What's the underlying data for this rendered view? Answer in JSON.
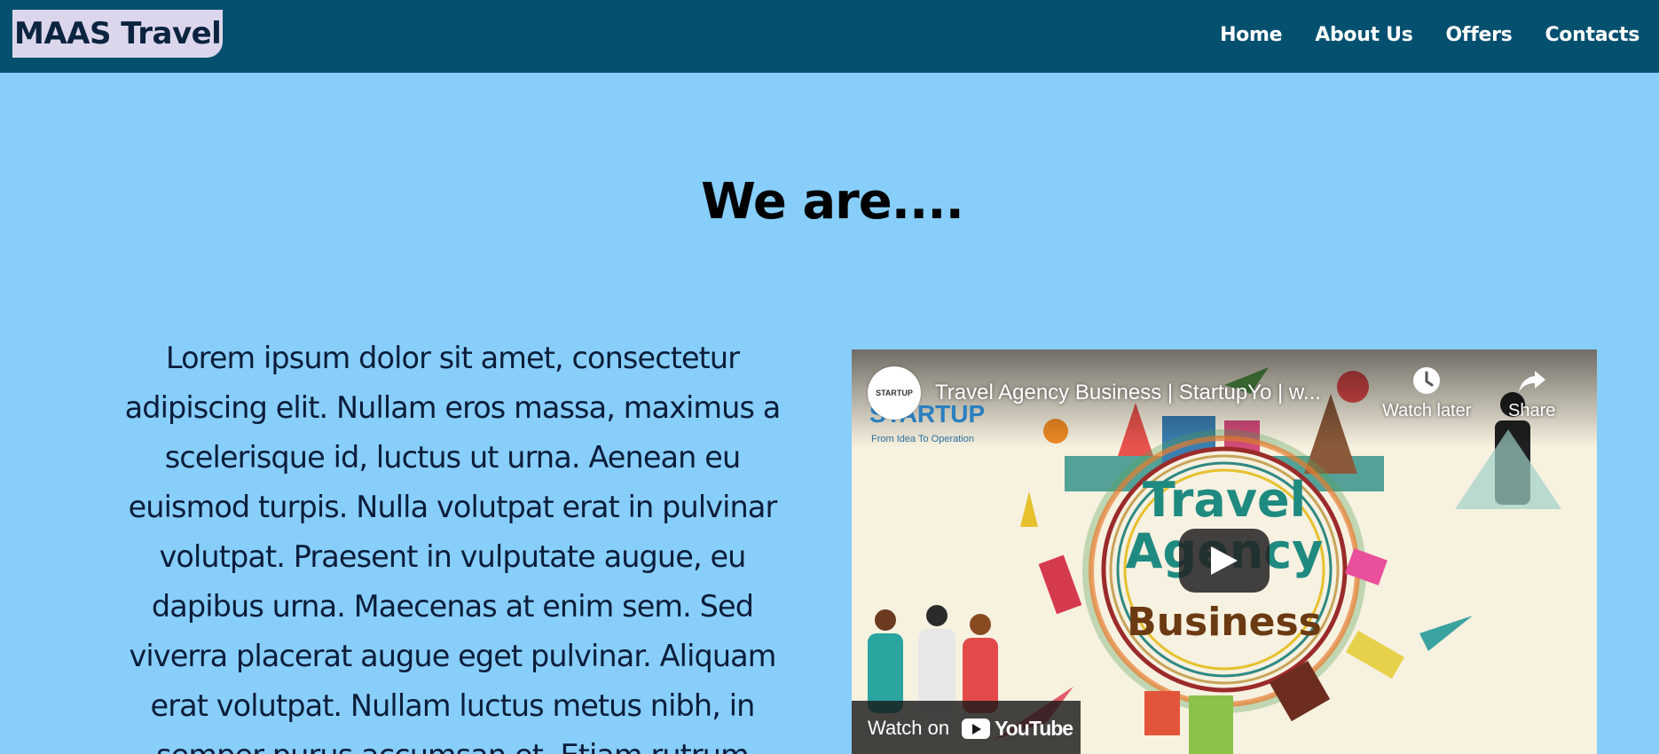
{
  "header": {
    "logo": "MAAS Travel",
    "nav": [
      {
        "label": "Home"
      },
      {
        "label": "About Us"
      },
      {
        "label": "Offers"
      },
      {
        "label": "Contacts"
      }
    ]
  },
  "main": {
    "heading": "We are....",
    "paragraph": "Lorem ipsum dolor sit amet, consectetur adipiscing elit. Nullam eros massa, maximus a scelerisque id, luctus ut urna. Aenean eu euismod turpis. Nulla volutpat erat in pulvinar volutpat. Praesent in vulputate augue, eu dapibus urna. Maecenas at enim sem. Sed viverra placerat augue eget pulvinar. Aliquam erat volutpat. Nullam luctus metus nibh, in semper purus accumsan et. Etiam rutrum"
  },
  "video": {
    "title": "Travel Agency Business | StartupYo | w...",
    "channel_avatar_text": "STARTUP",
    "watch_later": "Watch later",
    "share": "Share",
    "watch_on": "Watch on",
    "youtube": "YouTube",
    "thumb_brand": "STARTUP",
    "thumb_tagline": "From Idea To Operation",
    "thumb_line1": "Travel",
    "thumb_line2": "Agency",
    "thumb_line3": "Business"
  },
  "colors": {
    "page_background": "#87cefa",
    "navbar": "#03506f",
    "logo_background": "#dcd6ec",
    "thumb_teal": "#1f8a80",
    "thumb_brown": "#6b3a12"
  }
}
